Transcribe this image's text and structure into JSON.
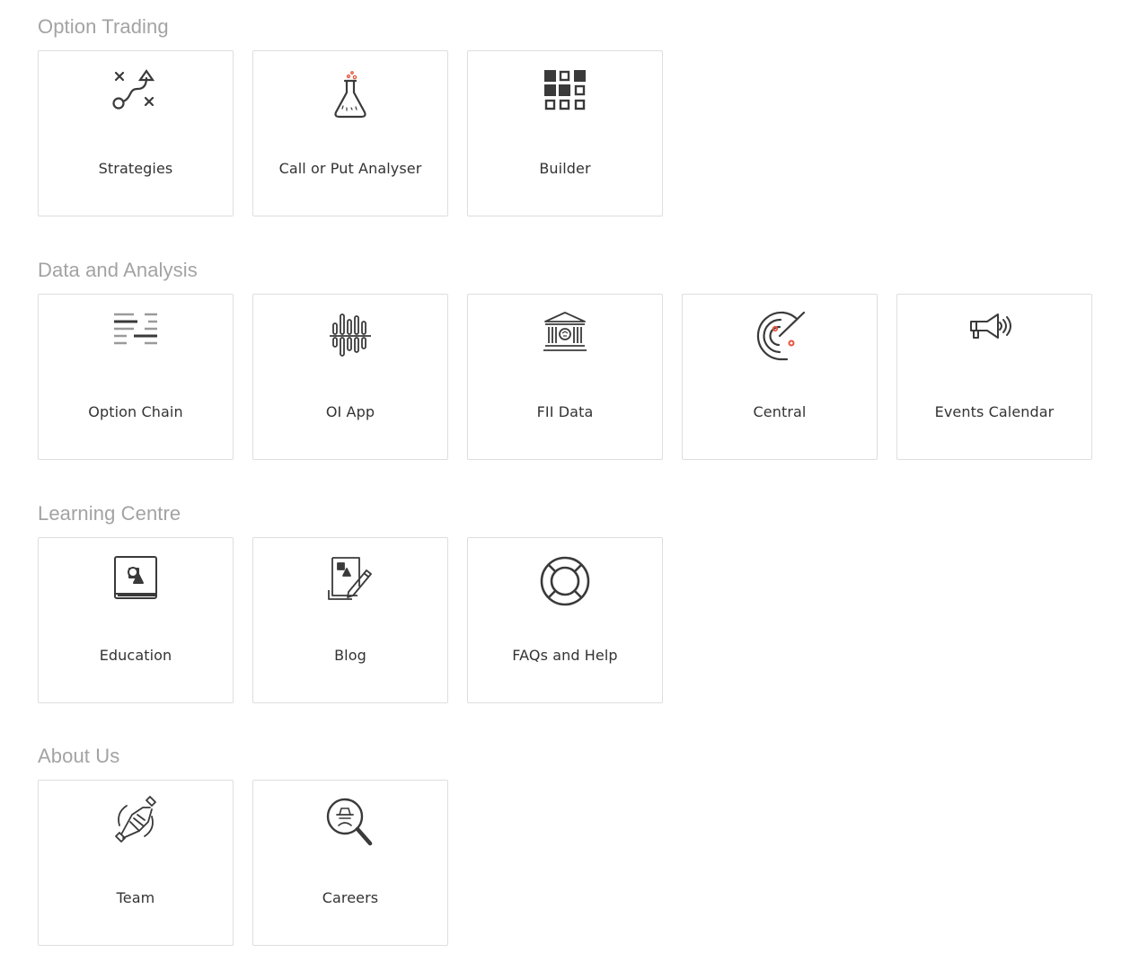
{
  "colors": {
    "section_title": "#a3a3a3",
    "card_border": "#dedede",
    "card_label": "#333333",
    "icon_dark": "#3a3a3a",
    "icon_accent": "#e8543d"
  },
  "sections": [
    {
      "title": "Option Trading",
      "cards": [
        {
          "label": "Strategies",
          "icon": "strategy-path-icon"
        },
        {
          "label": "Call or Put Analyser",
          "icon": "flask-icon"
        },
        {
          "label": "Builder",
          "icon": "grid-blocks-icon"
        }
      ]
    },
    {
      "title": "Data and Analysis",
      "cards": [
        {
          "label": "Option Chain",
          "icon": "chain-lines-icon"
        },
        {
          "label": "OI App",
          "icon": "bars-icon"
        },
        {
          "label": "FII Data",
          "icon": "bank-icon"
        },
        {
          "label": "Central",
          "icon": "radar-icon"
        },
        {
          "label": "Events Calendar",
          "icon": "megaphone-icon"
        }
      ]
    },
    {
      "title": "Learning Centre",
      "cards": [
        {
          "label": "Education",
          "icon": "book-icon"
        },
        {
          "label": "Blog",
          "icon": "pencil-paper-icon"
        },
        {
          "label": "FAQs and Help",
          "icon": "lifebuoy-icon"
        }
      ]
    },
    {
      "title": "About Us",
      "cards": [
        {
          "label": "Team",
          "icon": "handshake-icon"
        },
        {
          "label": "Careers",
          "icon": "magnifier-spy-icon"
        }
      ]
    }
  ]
}
